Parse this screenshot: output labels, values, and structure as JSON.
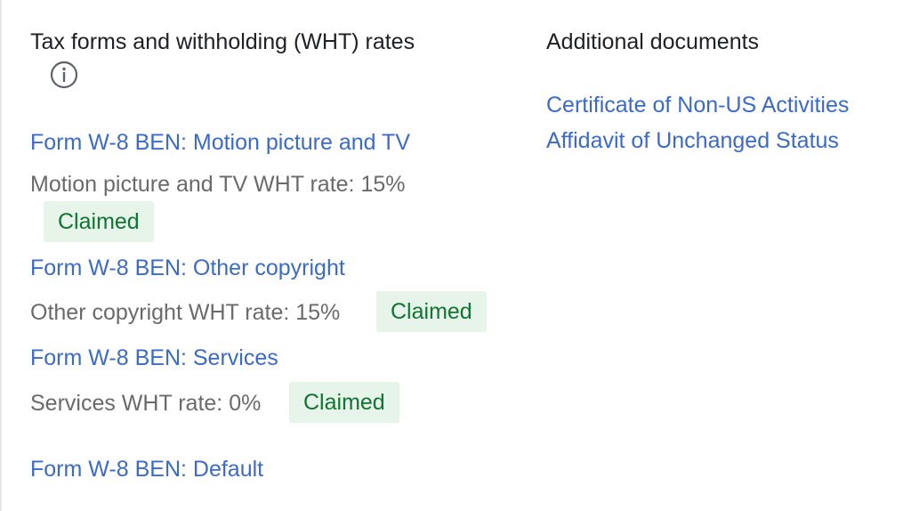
{
  "tax_section": {
    "heading": "Tax forms and withholding (WHT) rates",
    "info_icon": "info-icon",
    "forms": [
      {
        "link": "Form W-8 BEN: Motion picture and TV",
        "rate_text": "Motion picture and TV WHT rate: 15%",
        "status": "Claimed"
      },
      {
        "link": "Form W-8 BEN: Other copyright",
        "rate_text": "Other copyright WHT rate: 15%",
        "status": "Claimed"
      },
      {
        "link": "Form W-8 BEN: Services",
        "rate_text": "Services WHT rate: 0%",
        "status": "Claimed"
      },
      {
        "link": "Form W-8 BEN: Default"
      }
    ]
  },
  "additional_documents": {
    "heading": "Additional documents",
    "links": [
      "Certificate of Non-US Activities",
      "Affidavit of Unchanged Status"
    ]
  },
  "colors": {
    "link": "#3c6bc7",
    "claimed_bg": "#e6f4ea",
    "claimed_text": "#137333",
    "muted_text": "#6a6a6a"
  }
}
